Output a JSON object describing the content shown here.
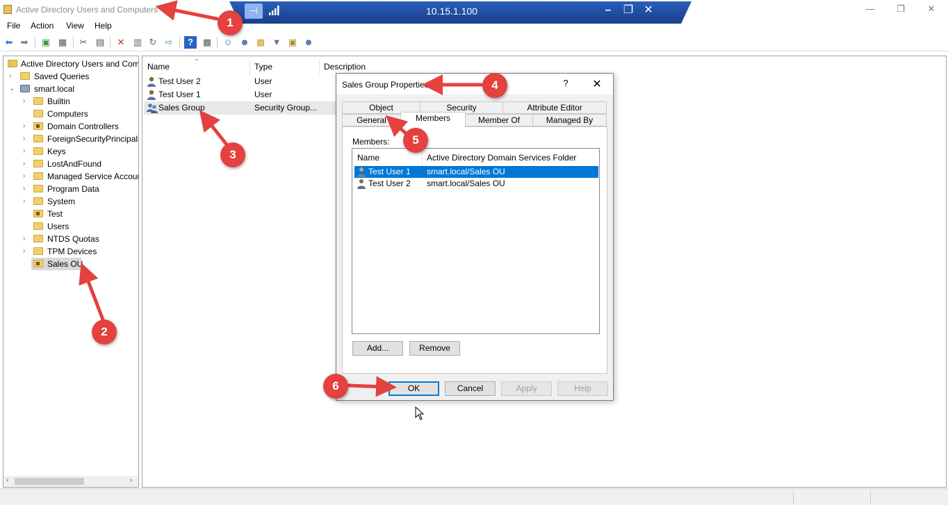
{
  "window": {
    "title": "Active Directory Users and Computers",
    "controls": {
      "minimize": "—",
      "maximize": "❐",
      "close": "✕"
    }
  },
  "remote_bar": {
    "host": "10.15.1.100",
    "pin_icon": "pin-icon",
    "signal_icon": "signal-bars-icon",
    "controls": {
      "minimize": "–",
      "restore": "❐",
      "close": "✕"
    },
    "color": "#1c4fa3"
  },
  "menu": {
    "items": [
      "File",
      "Action",
      "View",
      "Help"
    ]
  },
  "toolbar": {
    "icons": [
      "back-arrow-icon",
      "forward-arrow-icon",
      "up-folder-icon",
      "show-tree-icon",
      "cut-icon",
      "copy-icon",
      "delete-icon",
      "properties-icon",
      "refresh-icon",
      "export-icon",
      "help-icon",
      "console-view-icon",
      "new-user-icon",
      "new-group-icon",
      "new-ou-icon",
      "filter-icon",
      "find-icon",
      "add-to-group-icon"
    ]
  },
  "tree": {
    "root": "Active Directory Users and Com",
    "saved_queries": "Saved Queries",
    "domain": "smart.local",
    "children": [
      {
        "label": "Builtin",
        "type": "folder"
      },
      {
        "label": "Computers",
        "type": "folder"
      },
      {
        "label": "Domain Controllers",
        "type": "ou"
      },
      {
        "label": "ForeignSecurityPrincipals",
        "type": "folder"
      },
      {
        "label": "Keys",
        "type": "folder"
      },
      {
        "label": "LostAndFound",
        "type": "folder"
      },
      {
        "label": "Managed Service Accour",
        "type": "folder"
      },
      {
        "label": "Program Data",
        "type": "folder"
      },
      {
        "label": "System",
        "type": "folder"
      },
      {
        "label": "Test",
        "type": "ou"
      },
      {
        "label": "Users",
        "type": "folder"
      },
      {
        "label": "NTDS Quotas",
        "type": "folder"
      },
      {
        "label": "TPM Devices",
        "type": "folder"
      },
      {
        "label": "Sales OU",
        "type": "ou",
        "selected": true
      }
    ]
  },
  "list": {
    "columns": [
      "Name",
      "Type",
      "Description"
    ],
    "rows": [
      {
        "name": "Test User 2",
        "type": "User",
        "icon": "user-icon"
      },
      {
        "name": "Test User 1",
        "type": "User",
        "icon": "user-icon"
      },
      {
        "name": "Sales Group",
        "type": "Security Group...",
        "icon": "group-icon",
        "selected": true
      }
    ]
  },
  "dialog": {
    "title": "Sales Group Properties",
    "help": "?",
    "close": "✕",
    "tabs_row1": [
      "Object",
      "Security",
      "Attribute Editor"
    ],
    "tabs_row2": [
      "General",
      "Members",
      "Member Of",
      "Managed By"
    ],
    "active_tab": "Members",
    "members_label": "Members:",
    "members_columns": [
      "Name",
      "Active Directory Domain Services Folder"
    ],
    "members": [
      {
        "name": "Test User 1",
        "folder": "smart.local/Sales OU",
        "selected": true
      },
      {
        "name": "Test User 2",
        "folder": "smart.local/Sales OU"
      }
    ],
    "buttons": {
      "add": "Add...",
      "remove": "Remove",
      "ok": "OK",
      "cancel": "Cancel",
      "apply": "Apply",
      "help": "Help"
    }
  },
  "annotations": {
    "color": "#e4413f",
    "badges": [
      "1",
      "2",
      "3",
      "4",
      "5",
      "6"
    ]
  }
}
